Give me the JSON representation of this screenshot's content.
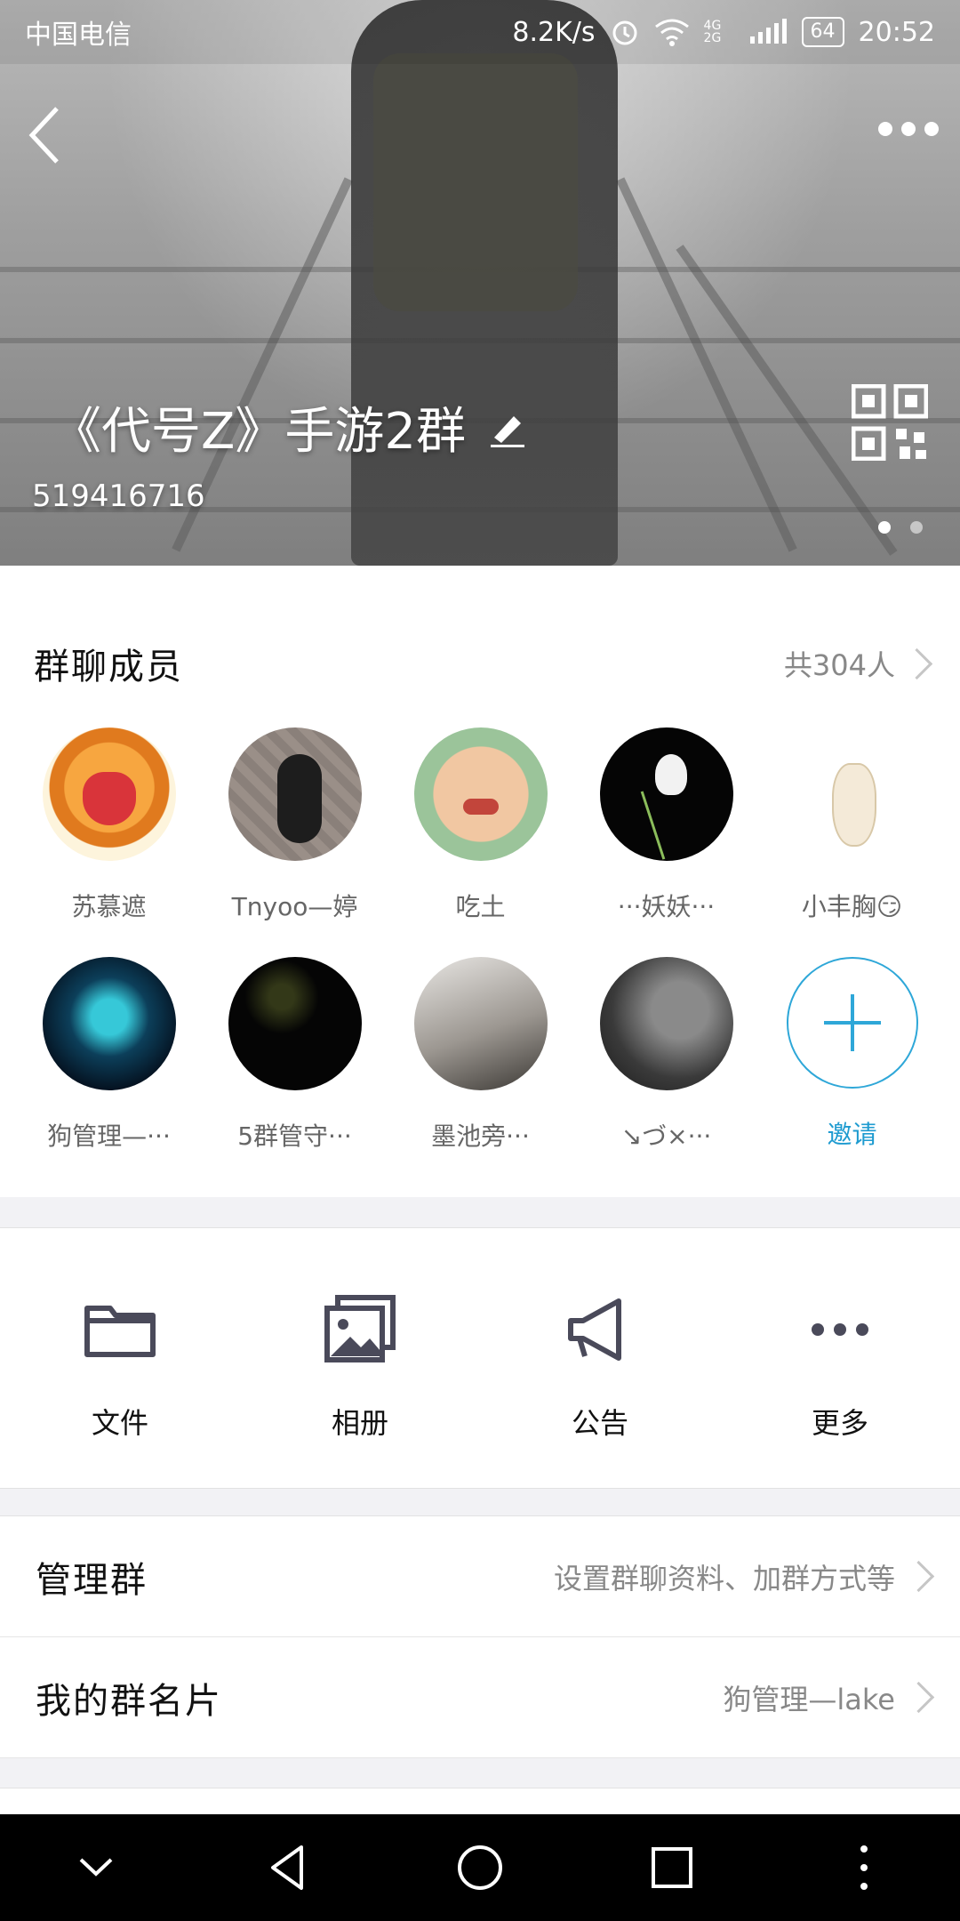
{
  "status_bar": {
    "carrier": "中国电信",
    "speed": "8.2K/s",
    "network": "4G 2G",
    "battery": "64",
    "time": "20:52"
  },
  "header": {
    "group_name": "《代号Z》手游2群",
    "group_id": "519416716",
    "icons": [
      "back-icon",
      "more-icon",
      "edit-icon",
      "qr-code-icon"
    ]
  },
  "members": {
    "title": "群聊成员",
    "count": "共304人",
    "items": [
      {
        "name": "苏慕遮"
      },
      {
        "name": "Tnyoo—婷"
      },
      {
        "name": "吃土"
      },
      {
        "name": "···妖妖···"
      },
      {
        "name": "小丰胸😏"
      },
      {
        "name": "狗管理—···"
      },
      {
        "name": "5群管守···"
      },
      {
        "name": "墨池旁···"
      },
      {
        "name": "↘づ×···"
      }
    ],
    "invite_label": "邀请"
  },
  "actions": [
    {
      "label": "文件",
      "icon": "folder-icon"
    },
    {
      "label": "相册",
      "icon": "album-icon"
    },
    {
      "label": "公告",
      "icon": "megaphone-icon"
    },
    {
      "label": "更多",
      "icon": "more-dots-icon"
    }
  ],
  "settings": {
    "manage_label": "管理群",
    "manage_value": "设置群聊资料、加群方式等",
    "card_label": "我的群名片",
    "card_value": "狗管理—lake"
  },
  "colors": {
    "accent": "#1e9bd0",
    "icon_gray": "#4a4a5a",
    "secondary_text": "#888888"
  }
}
